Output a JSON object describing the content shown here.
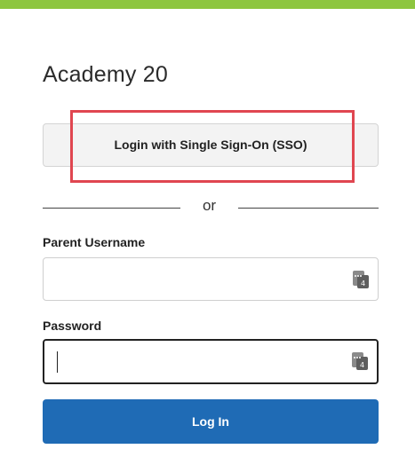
{
  "title": "Academy 20",
  "sso_button": {
    "label": "Login with Single Sign-On (SSO)"
  },
  "divider": {
    "text": "or"
  },
  "username": {
    "label": "Parent Username",
    "value": "",
    "placeholder": ""
  },
  "password": {
    "label": "Password",
    "value": "",
    "placeholder": ""
  },
  "login_button": {
    "label": "Log In"
  },
  "colors": {
    "accent_bar": "#8dc63f",
    "primary_button": "#1f6bb5",
    "highlight": "#e04650"
  },
  "icons": {
    "field_icon": "password-manager-icon"
  }
}
